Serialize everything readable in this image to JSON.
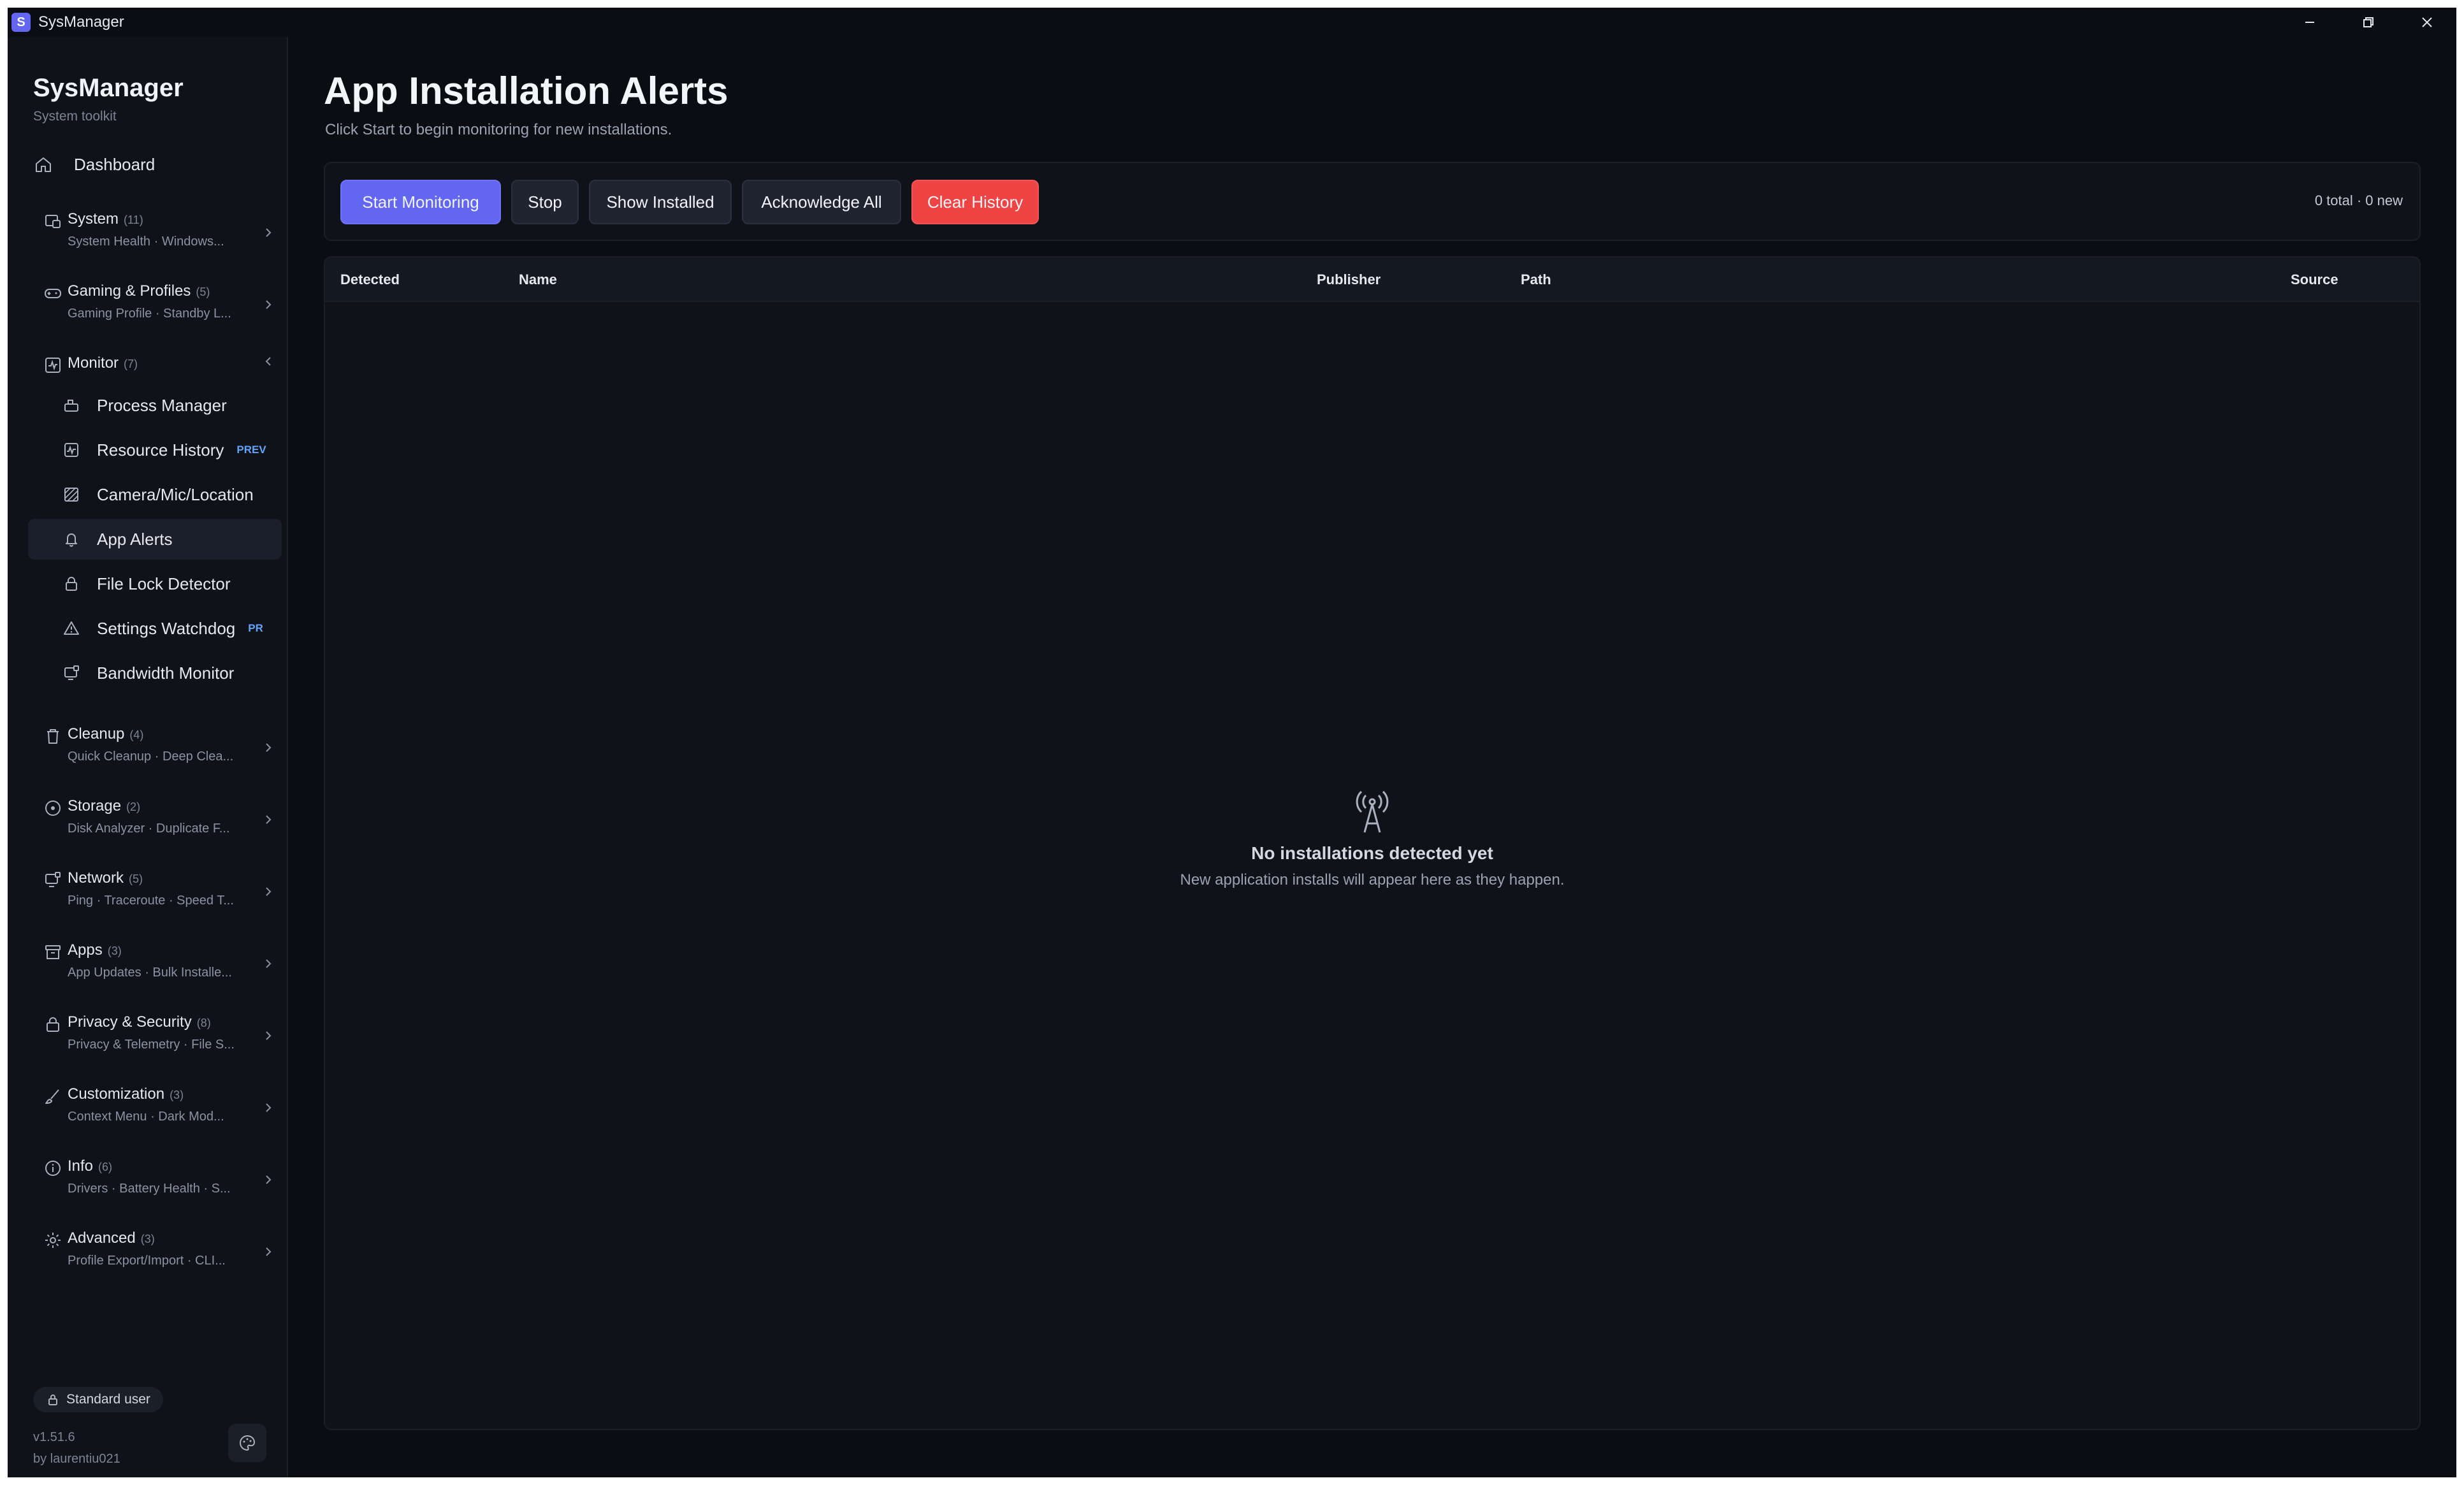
{
  "window": {
    "title": "SysManager",
    "badge": "S"
  },
  "sidebar": {
    "brand_title": "SysManager",
    "brand_sub": "System toolkit",
    "dashboard": "Dashboard",
    "groups": [
      {
        "title": "System",
        "count": "(11)",
        "sub": "System Health · Windows..."
      },
      {
        "title": "Gaming & Profiles",
        "count": "(5)",
        "sub": "Gaming Profile · Standby L..."
      },
      {
        "title": "Monitor",
        "count": "(7)",
        "sub": ""
      },
      {
        "title": "Cleanup",
        "count": "(4)",
        "sub": "Quick Cleanup · Deep Clea..."
      },
      {
        "title": "Storage",
        "count": "(2)",
        "sub": "Disk Analyzer · Duplicate F..."
      },
      {
        "title": "Network",
        "count": "(5)",
        "sub": "Ping · Traceroute · Speed T..."
      },
      {
        "title": "Apps",
        "count": "(3)",
        "sub": "App Updates · Bulk Installe..."
      },
      {
        "title": "Privacy & Security",
        "count": "(8)",
        "sub": "Privacy & Telemetry · File S..."
      },
      {
        "title": "Customization",
        "count": "(3)",
        "sub": "Context Menu · Dark Mod..."
      },
      {
        "title": "Info",
        "count": "(6)",
        "sub": "Drivers · Battery Health · S..."
      },
      {
        "title": "Advanced",
        "count": "(3)",
        "sub": "Profile Export/Import · CLI..."
      }
    ],
    "monitor_items": [
      {
        "label": "Process Manager",
        "tag": ""
      },
      {
        "label": "Resource History",
        "tag": "PREV"
      },
      {
        "label": "Camera/Mic/Location",
        "tag": ""
      },
      {
        "label": "App Alerts",
        "tag": ""
      },
      {
        "label": "File Lock Detector",
        "tag": ""
      },
      {
        "label": "Settings Watchdog",
        "tag": "PR"
      },
      {
        "label": "Bandwidth Monitor",
        "tag": ""
      }
    ],
    "user_role": "Standard user",
    "version": "v1.51.6",
    "author": "by laurentiu021"
  },
  "main": {
    "title": "App Installation Alerts",
    "subtitle": "Click Start to begin monitoring for new installations.",
    "buttons": {
      "start": "Start Monitoring",
      "stop": "Stop",
      "show_installed": "Show Installed",
      "ack_all": "Acknowledge All",
      "clear": "Clear History"
    },
    "counts": "0 total · 0 new",
    "columns": [
      "Detected",
      "Name",
      "Publisher",
      "Path",
      "Source"
    ],
    "empty_title": "No installations detected yet",
    "empty_sub": "New application installs will appear here as they happen."
  },
  "colors": {
    "accent": "#6366f1",
    "danger": "#ef4444",
    "preview_tag": "#60a5fa",
    "background": "#0b0d12",
    "sidebar": "#0f1218"
  }
}
